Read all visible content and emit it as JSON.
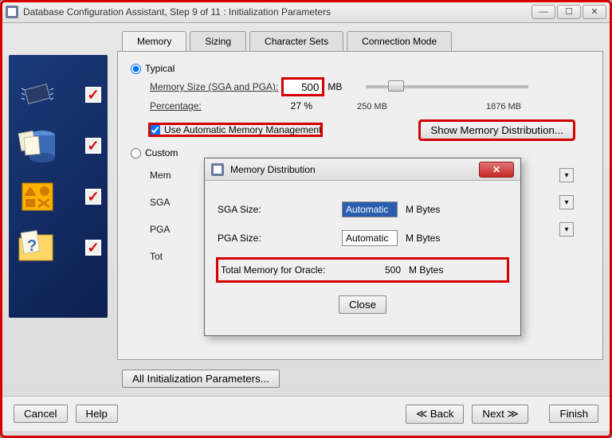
{
  "window": {
    "title": "Database Configuration Assistant, Step 9 of 11 : Initialization Parameters"
  },
  "tabs": [
    "Memory",
    "Sizing",
    "Character Sets",
    "Connection Mode"
  ],
  "memory": {
    "typical_label": "Typical",
    "mem_size_label": "Memory Size (SGA and PGA):",
    "mem_size_value": "500",
    "mem_size_unit": "MB",
    "percent_label": "Percentage:",
    "percent_value": "27 %",
    "slider_min": "250 MB",
    "slider_max": "1876 MB",
    "auto_label": "Use Automatic Memory Management",
    "show_dist_btn": "Show Memory Distribution...",
    "custom_label": "Custom",
    "custom_rows": {
      "mem": "Mem",
      "sga": "SGA",
      "pga": "PGA",
      "tot": "Tot"
    }
  },
  "all_params_btn": "All Initialization Parameters...",
  "footer": {
    "cancel": "Cancel",
    "help": "Help",
    "back": "Back",
    "next": "Next",
    "finish": "Finish"
  },
  "dialog": {
    "title": "Memory Distribution",
    "sga_label": "SGA Size:",
    "sga_value": "Automatic",
    "pga_label": "PGA Size:",
    "pga_value": "Automatic",
    "unit": "M Bytes",
    "total_label": "Total Memory for Oracle:",
    "total_value": "500",
    "close": "Close"
  }
}
